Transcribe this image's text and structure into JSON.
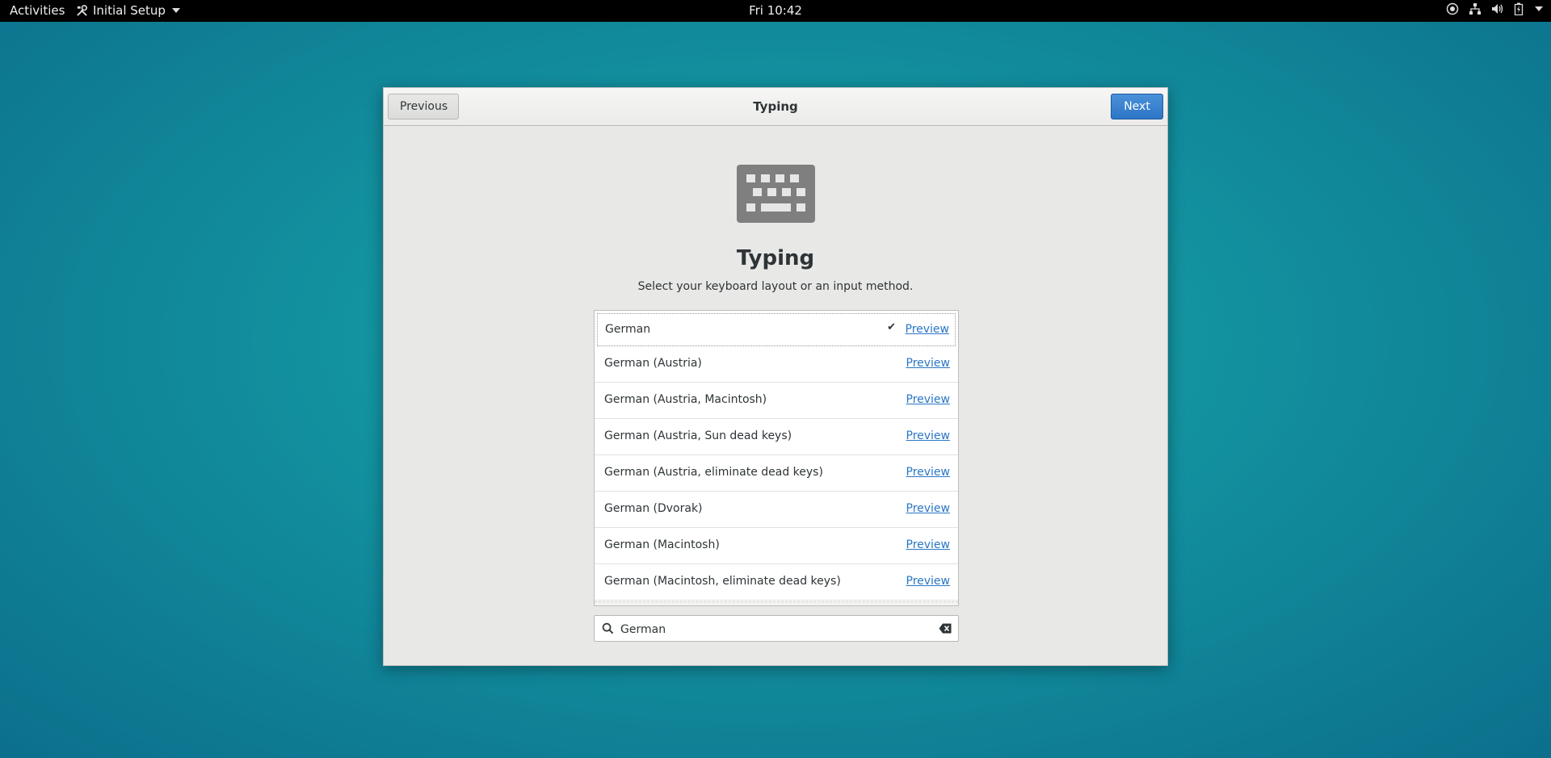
{
  "topbar": {
    "activities": "Activities",
    "app_menu": "Initial Setup",
    "clock": "Fri 10:42",
    "tray_icons": [
      "accessibility-icon",
      "network-icon",
      "volume-icon",
      "battery-icon",
      "system-menu-arrow-icon"
    ]
  },
  "window": {
    "title": "Typing",
    "previous_label": "Previous",
    "next_label": "Next",
    "accent_color": "#2d76c7"
  },
  "page": {
    "icon": "keyboard-icon",
    "heading": "Typing",
    "subtitle": "Select your keyboard layout or an input method."
  },
  "layouts": [
    {
      "name": "German",
      "preview": "Preview",
      "selected": true,
      "check": "✔"
    },
    {
      "name": "German (Austria)",
      "preview": "Preview",
      "selected": false
    },
    {
      "name": "German (Austria, Macintosh)",
      "preview": "Preview",
      "selected": false
    },
    {
      "name": "German (Austria, Sun dead keys)",
      "preview": "Preview",
      "selected": false
    },
    {
      "name": "German (Austria, eliminate dead keys)",
      "preview": "Preview",
      "selected": false
    },
    {
      "name": "German (Dvorak)",
      "preview": "Preview",
      "selected": false
    },
    {
      "name": "German (Macintosh)",
      "preview": "Preview",
      "selected": false
    },
    {
      "name": "German (Macintosh, eliminate dead keys)",
      "preview": "Preview",
      "selected": false
    }
  ],
  "search": {
    "value": "German",
    "icon": "search-icon",
    "clear_icon": "clear-icon"
  }
}
